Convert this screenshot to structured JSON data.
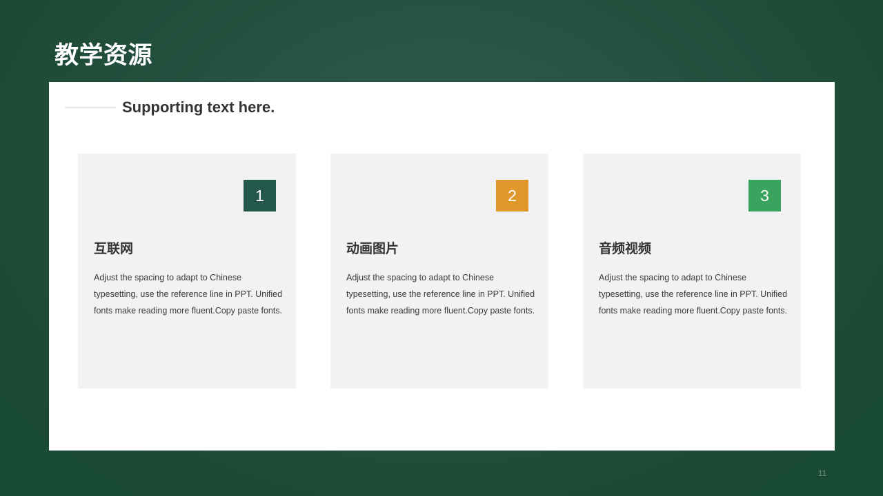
{
  "slide": {
    "title": "教学资源",
    "subtitle": "Supporting text here.",
    "page_number": "11"
  },
  "cards": [
    {
      "number": "1",
      "badge_color": "#24584a",
      "heading": "互联网",
      "body": "Adjust the spacing to adapt to Chinese typesetting, use the reference line in PPT. Unified fonts make reading more fluent.Copy paste fonts."
    },
    {
      "number": "2",
      "badge_color": "#e0972c",
      "heading": "动画图片",
      "body": "Adjust the spacing to adapt to Chinese typesetting, use the reference line in PPT. Unified fonts make reading more fluent.Copy paste fonts."
    },
    {
      "number": "3",
      "badge_color": "#3aa45e",
      "heading": "音频视频",
      "body": "Adjust the spacing to adapt to Chinese typesetting, use the reference line in PPT. Unified fonts make reading more fluent.Copy paste fonts."
    }
  ],
  "colors": {
    "background": "#24513f",
    "panel": "#ffffff",
    "card": "#f2f2f2",
    "text": "#333333"
  }
}
